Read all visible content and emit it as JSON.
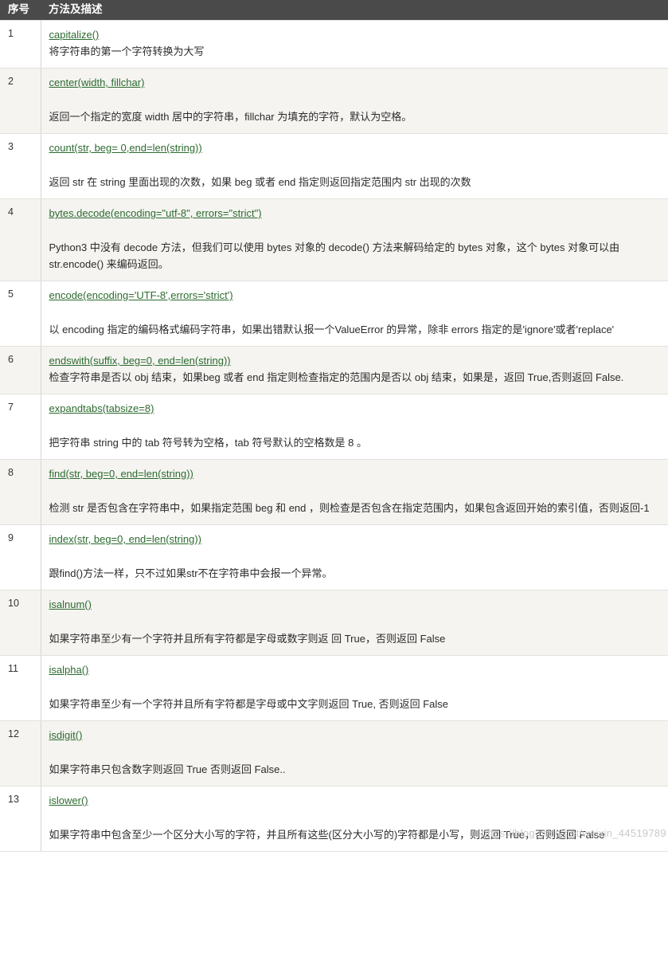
{
  "header": {
    "col_index": "序号",
    "col_desc": "方法及描述",
    "bg_color": "#4a4a4a",
    "text_color": "#ffffff"
  },
  "style": {
    "link_color": "#2c6b2f",
    "stripe_color": "#f5f4f1",
    "row_color": "#ffffff",
    "border_color": "#e3e1dc",
    "text_color": "#2b2b2b"
  },
  "watermark": {
    "text": "https://blog.csdn.net/weixin_44519789",
    "color": "#c9c9c9"
  },
  "rows": [
    {
      "index": "1",
      "signature": "capitalize()",
      "gap": false,
      "description": "将字符串的第一个字符转换为大写"
    },
    {
      "index": "2",
      "signature": "center(width, fillchar)",
      "gap": true,
      "description": "返回一个指定的宽度 width 居中的字符串，fillchar 为填充的字符，默认为空格。"
    },
    {
      "index": "3",
      "signature": "count(str, beg= 0,end=len(string))",
      "gap": true,
      "description": "返回 str 在 string 里面出现的次数，如果 beg 或者 end 指定则返回指定范围内 str 出现的次数"
    },
    {
      "index": "4",
      "signature": "bytes.decode(encoding=\"utf-8\", errors=\"strict\")",
      "gap": true,
      "description": "Python3 中没有 decode 方法，但我们可以使用 bytes 对象的 decode() 方法来解码给定的 bytes 对象，这个 bytes 对象可以由 str.encode() 来编码返回。"
    },
    {
      "index": "5",
      "signature": "encode(encoding='UTF-8',errors='strict')",
      "gap": true,
      "description": "以 encoding 指定的编码格式编码字符串，如果出错默认报一个ValueError 的异常，除非 errors 指定的是'ignore'或者'replace'"
    },
    {
      "index": "6",
      "signature": "endswith(suffix, beg=0, end=len(string))",
      "gap": false,
      "description": "检查字符串是否以 obj 结束，如果beg 或者 end 指定则检查指定的范围内是否以 obj 结束，如果是，返回 True,否则返回 False."
    },
    {
      "index": "7",
      "signature": "expandtabs(tabsize=8)",
      "gap": true,
      "description": "把字符串 string 中的 tab 符号转为空格，tab 符号默认的空格数是 8 。"
    },
    {
      "index": "8",
      "signature": "find(str, beg=0, end=len(string))",
      "gap": true,
      "description": "检测 str 是否包含在字符串中，如果指定范围 beg 和 end ，则检查是否包含在指定范围内，如果包含返回开始的索引值，否则返回-1"
    },
    {
      "index": "9",
      "signature": "index(str, beg=0, end=len(string))",
      "gap": true,
      "description": "跟find()方法一样，只不过如果str不在字符串中会报一个异常。"
    },
    {
      "index": "10",
      "signature": "isalnum()",
      "gap": true,
      "description": "如果字符串至少有一个字符并且所有字符都是字母或数字则返 回 True，否则返回 False"
    },
    {
      "index": "11",
      "signature": "isalpha()",
      "gap": true,
      "description": "如果字符串至少有一个字符并且所有字符都是字母或中文字则返回 True, 否则返回 False"
    },
    {
      "index": "12",
      "signature": "isdigit()",
      "gap": true,
      "description": "如果字符串只包含数字则返回 True 否则返回 False.."
    },
    {
      "index": "13",
      "signature": "islower()",
      "gap": true,
      "description": "如果字符串中包含至少一个区分大小写的字符，并且所有这些(区分大小写的)字符都是小写，则返回 True，否则返回 False"
    }
  ]
}
